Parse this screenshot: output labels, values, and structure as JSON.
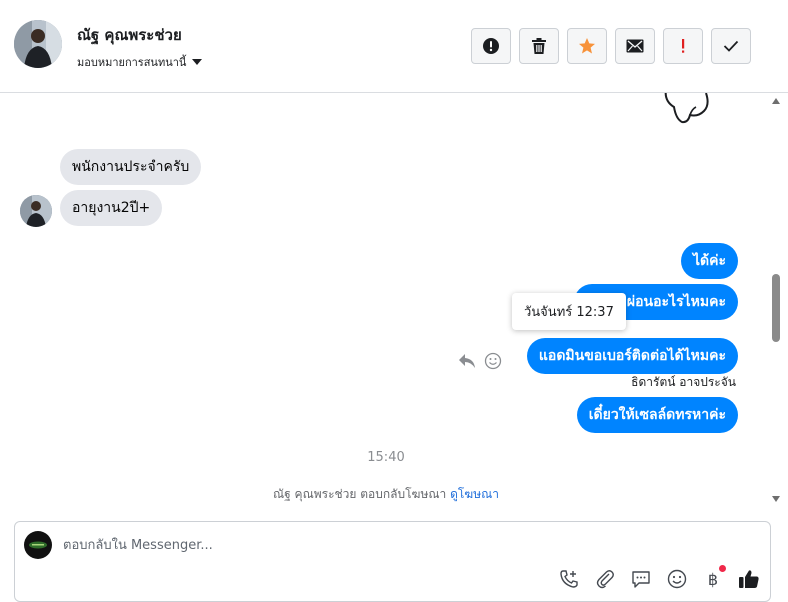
{
  "header": {
    "contact_name": "ณัฐ คุณพระช่วย",
    "assign_label": "มอบหมายการสนทนานี้",
    "toolbar": [
      {
        "name": "report-spam-button",
        "icon": "exclamation-circle-icon"
      },
      {
        "name": "delete-button",
        "icon": "trash-icon"
      },
      {
        "name": "star-button",
        "icon": "star-icon"
      },
      {
        "name": "mark-unread-button",
        "icon": "envelope-icon"
      },
      {
        "name": "follow-up-button",
        "icon": "exclamation-icon"
      },
      {
        "name": "mark-done-button",
        "icon": "checkmark-icon"
      }
    ]
  },
  "messages": {
    "incoming_1": "พนักงานประจำครับ",
    "incoming_2": "อายุงาน2ปี+",
    "outgoing_1": "ได้ค่ะ",
    "outgoing_2": "มีภาระผ่อนอะไรไหมคะ",
    "outgoing_3": "แอดมินขอเบอร์ติดต่อได้ไหมคะ",
    "outgoing_4": "เดี๋ยวให้เซลล์ดทรหาค่ะ"
  },
  "tooltip_time": "วันจันทร์ 12:37",
  "sender_label": "ธิดารัตน์ อาจประจัน",
  "time_separator": "15:40",
  "ad_note": {
    "text": "ณัฐ คุณพระช่วย ตอบกลับโฆษณา",
    "link": "ดูโฆษณา"
  },
  "composer": {
    "placeholder": "ตอบกลับใน Messenger...",
    "tools": [
      "phone-add-icon",
      "paperclip-icon",
      "saved-replies-icon",
      "emoji-icon",
      "baht-payment-icon",
      "thumbs-up-icon"
    ],
    "baht_symbol": "฿"
  },
  "colors": {
    "outgoing_bubble": "#0084ff",
    "incoming_bubble": "#e4e6eb",
    "star": "#f7923a",
    "follow_up": "#e02020",
    "link": "#216fdb"
  }
}
